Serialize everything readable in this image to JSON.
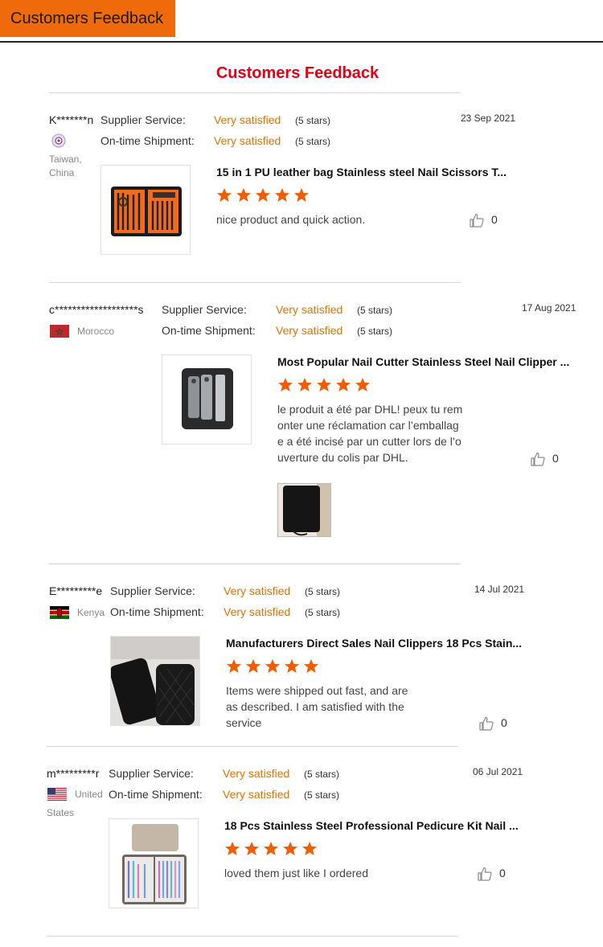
{
  "header": {
    "tab_label": "Customers Feedback",
    "title": "Customers Feedback"
  },
  "labels": {
    "supplier": "Supplier Service:",
    "shipment": "On-time Shipment:"
  },
  "colors": {
    "accent": "#ee6a0a",
    "title_red": "#e60012",
    "satisfied": "#e37100",
    "star": "#f25c05"
  },
  "reviews": [
    {
      "name": "K*******n",
      "date": "23 Sep 2021",
      "country": "Taiwan, China",
      "flag": "taiwan-emblem",
      "supplier_rating": "Very satisfied",
      "supplier_stars": "(5 stars)",
      "shipment_rating": "Very satisfied",
      "shipment_stars": "(5 stars)",
      "product_title": "15 in 1 PU leather bag Stainless steel Nail Scissors T...",
      "rating": 5,
      "comment": "nice product and quick action.",
      "likes": "0"
    },
    {
      "name": "c*******************s",
      "date": "17 Aug 2021",
      "country": "Morocco",
      "flag": "morocco-flag",
      "supplier_rating": "Very satisfied",
      "supplier_stars": "(5 stars)",
      "shipment_rating": "Very satisfied",
      "shipment_stars": "(5 stars)",
      "product_title": "Most Popular Nail Cutter Stainless Steel Nail Clipper ...",
      "rating": 5,
      "comment_lines": [
        "le produit a été par DHL! peux tu rem",
        "onter une réclamation car l’emballag",
        "e a été incisé par un cutter lors de l’o",
        "uverture du colis par DHL."
      ],
      "likes": "0"
    },
    {
      "name": "E*********e",
      "date": "14 Jul 2021",
      "country": "Kenya",
      "flag": "kenya-flag",
      "supplier_rating": "Very satisfied",
      "supplier_stars": "(5 stars)",
      "shipment_rating": "Very satisfied",
      "shipment_stars": "(5 stars)",
      "product_title": "Manufacturers Direct Sales Nail Clippers 18 Pcs Stain...",
      "rating": 5,
      "comment_lines": [
        "Items were shipped out fast, and are",
        "as described. I am satisfied with the",
        "service"
      ],
      "likes": "0"
    },
    {
      "name": "m*********r",
      "date": "06 Jul 2021",
      "country_line1": "United",
      "country_line2": "States",
      "flag": "usa-flag",
      "supplier_rating": "Very satisfied",
      "supplier_stars": "(5 stars)",
      "shipment_rating": "Very satisfied",
      "shipment_stars": "(5 stars)",
      "product_title": "18 Pcs Stainless Steel Professional Pedicure Kit Nail ...",
      "rating": 5,
      "comment": "loved them just like I ordered",
      "likes": "0"
    }
  ]
}
